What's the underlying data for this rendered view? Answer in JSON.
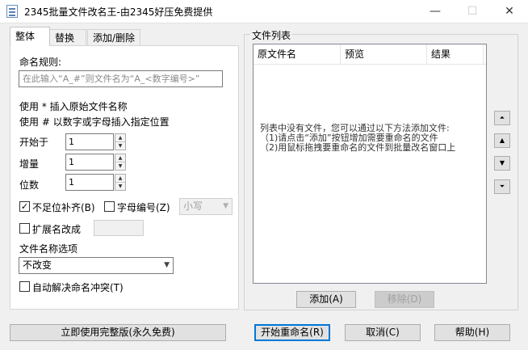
{
  "window": {
    "title": "2345批量文件改名王-由2345好压免费提供",
    "minimize_glyph": "—",
    "maximize_glyph": "☐",
    "close_glyph": "✕"
  },
  "tabs": [
    {
      "label": "整体",
      "active": true
    },
    {
      "label": "替换",
      "active": false
    },
    {
      "label": "添加/删除",
      "active": false
    }
  ],
  "rule": {
    "label": "命名规则:",
    "placeholder": "在此输入“A_#”则文件名为“A_<数字编号>”",
    "hint_star": "使用 * 插入原始文件名称",
    "hint_hash": "使用 # 以数字或字母插入指定位置"
  },
  "numbering": {
    "start_label": "开始于",
    "start_value": "1",
    "increment_label": "增量",
    "increment_value": "1",
    "digits_label": "位数",
    "digits_value": "1"
  },
  "options": {
    "pad_label": "不足位补齐(B)",
    "pad_checked": "✓",
    "letter_label": "字母编号(Z)",
    "case_value": "小写",
    "ext_label": "扩展名改成",
    "name_option_label": "文件名称选项",
    "name_option_value": "不改变",
    "auto_resolve_label": "自动解决命名冲突(T)"
  },
  "file_list": {
    "group_title": "文件列表",
    "columns": [
      "原文件名",
      "预览",
      "结果"
    ],
    "empty_lines": [
      "列表中没有文件，您可以通过以下方法添加文件:",
      "（1)请点击“添加”按钮增加需要重命名的文件",
      "（2)用鼠标拖拽要重命名的文件到批量改名窗口上"
    ],
    "add_button": "添加(A)",
    "remove_button": "移除(D)",
    "move_top_icon": "move-top-icon",
    "move_up_icon": "move-up-icon",
    "move_down_icon": "move-down-icon",
    "move_bottom_icon": "move-bottom-icon"
  },
  "bottom": {
    "full_version_button": "立即使用完整版(永久免费)",
    "start_button": "开始重命名(R)",
    "cancel_button": "取消(C)",
    "help_button": "帮助(H)"
  },
  "colors": {
    "accent": "#0078d7",
    "window_bg": "#f0f0f0"
  }
}
